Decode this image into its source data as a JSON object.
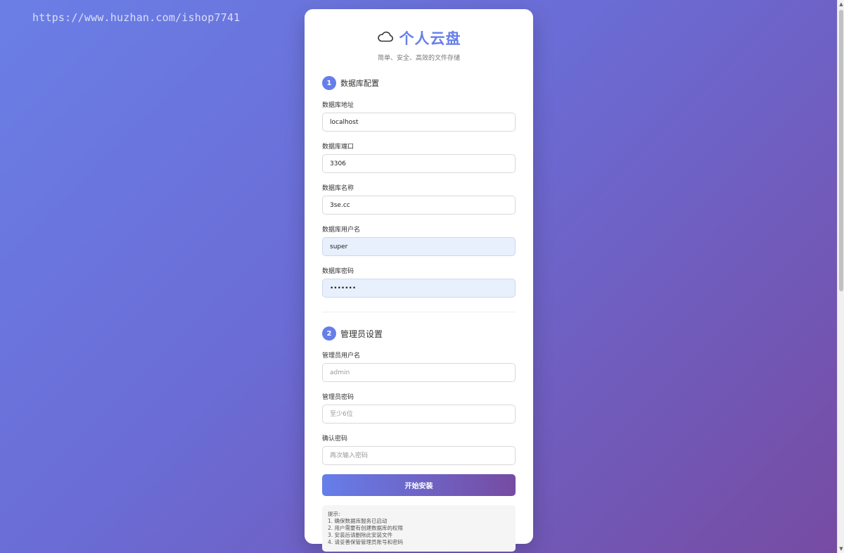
{
  "watermark": "https://www.huzhan.com/ishop7741",
  "header": {
    "icon": "cloud-icon",
    "title": "个人云盘",
    "subtitle": "简单、安全、高效的文件存储"
  },
  "section1": {
    "step": "1",
    "title": "数据库配置",
    "fields": [
      {
        "label": "数据库地址",
        "value": "localhost",
        "placeholder": ""
      },
      {
        "label": "数据库端口",
        "value": "3306",
        "placeholder": ""
      },
      {
        "label": "数据库名称",
        "value": "3se.cc",
        "placeholder": ""
      },
      {
        "label": "数据库用户名",
        "value": "super",
        "placeholder": ""
      },
      {
        "label": "数据库密码",
        "value": "•••••••",
        "placeholder": ""
      }
    ]
  },
  "section2": {
    "step": "2",
    "title": "管理员设置",
    "fields": [
      {
        "label": "管理员用户名",
        "value": "",
        "placeholder": "admin"
      },
      {
        "label": "管理员密码",
        "value": "",
        "placeholder": "至少6位"
      },
      {
        "label": "确认密码",
        "value": "",
        "placeholder": "再次输入密码"
      }
    ]
  },
  "submit_label": "开始安装",
  "tips": {
    "title": "提示:",
    "items": [
      "1. 确保数据库服务已启动",
      "2. 用户需要有创建数据库的权限",
      "3. 安装后请删除此安装文件",
      "4. 请妥善保管管理员账号和密码"
    ]
  },
  "colors": {
    "accent": "#667eea",
    "accent_end": "#764ba2",
    "autofill_bg": "#e8f0fe"
  }
}
